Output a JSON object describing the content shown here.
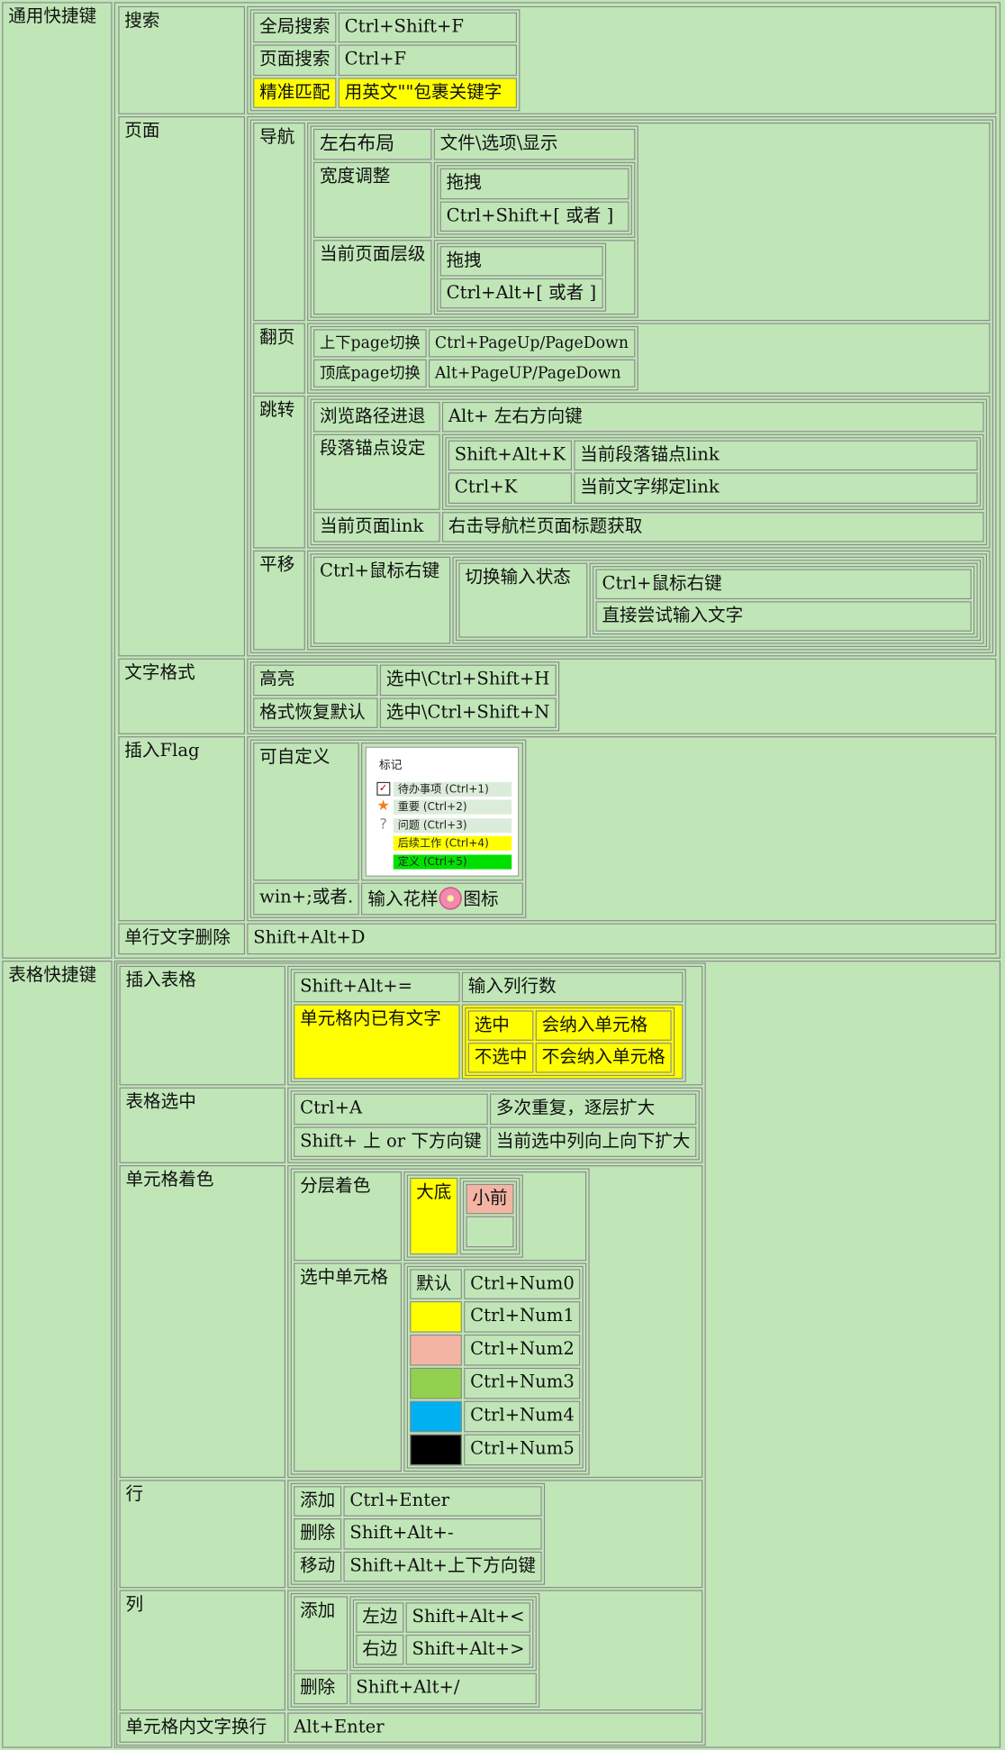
{
  "general": {
    "label": "通用快捷键",
    "search": {
      "label": "搜索",
      "rows": [
        {
          "k": "全局搜索",
          "v": "Ctrl+Shift+F"
        },
        {
          "k": "页面搜索",
          "v": "Ctrl+F"
        },
        {
          "k": "精准匹配",
          "v": "用英文\"\"包裹关键字"
        }
      ]
    },
    "page": {
      "label": "页面",
      "nav": {
        "label": "导航",
        "layout": {
          "k": "左右布局",
          "v": "文件\\选项\\显示"
        },
        "width": {
          "k": "宽度调整",
          "v1": "拖拽",
          "v2": "Ctrl+Shift+[ 或者 ]"
        },
        "level": {
          "k": "当前页面层级",
          "v1": "拖拽",
          "v2": "Ctrl+Alt+[ 或者 ]"
        }
      },
      "flip": {
        "label": "翻页",
        "rows": [
          {
            "k": "上下page切换",
            "v": "Ctrl+PageUp/PageDown"
          },
          {
            "k": "顶底page切换",
            "v": "Alt+PageUP/PageDown"
          }
        ]
      },
      "jump": {
        "label": "跳转",
        "history": {
          "k": "浏览路径进退",
          "v": "Alt+ 左右方向键"
        },
        "anchor": {
          "k": "段落锚点设定",
          "rows": [
            {
              "k": "Shift+Alt+K",
              "v": "当前段落锚点link"
            },
            {
              "k": "Ctrl+K",
              "v": "当前文字绑定link"
            }
          ]
        },
        "link": {
          "k": "当前页面link",
          "v": "右击导航栏页面标题获取"
        }
      },
      "pan": {
        "label": "平移",
        "key": "Ctrl+鼠标右键",
        "toggle": "切换输入状态",
        "opts": [
          "Ctrl+鼠标右键",
          "直接尝试输入文字"
        ]
      }
    },
    "textfmt": {
      "label": "文字格式",
      "rows": [
        {
          "k": "高亮",
          "v": "选中\\Ctrl+Shift+H"
        },
        {
          "k": "格式恢复默认",
          "v": "选中\\Ctrl+Shift+N"
        }
      ]
    },
    "flag": {
      "label": "插入Flag",
      "custom": "可自定义",
      "menu": {
        "title": "标记",
        "items": [
          {
            "icon": "checkbox-icon",
            "label": "待办事项 (Ctrl+1)",
            "bg": "#dcecda"
          },
          {
            "icon": "star-icon",
            "label": "重要 (Ctrl+2)",
            "bg": "#dcecda"
          },
          {
            "icon": "question-icon",
            "label": "问题 (Ctrl+3)",
            "bg": "#dcecda"
          },
          {
            "icon": "",
            "label": "后续工作 (Ctrl+4)",
            "bg": "#ffff00"
          },
          {
            "icon": "",
            "label": "定义 (Ctrl+5)",
            "bg": "#00e000"
          }
        ]
      },
      "alt_key": "win+;或者.",
      "alt_pre": "输入花样",
      "alt_icon": "flower-emoji-icon",
      "alt_post": "图标"
    },
    "delline": {
      "label": "单行文字删除",
      "v": "Shift+Alt+D"
    }
  },
  "table": {
    "label": "表格快捷键",
    "insert": {
      "label": "插入表格",
      "key": "Shift+Alt+=",
      "key_desc": "输入列行数",
      "has_text": "单元格内已有文字",
      "rows": [
        {
          "k": "选中",
          "v": "会纳入单元格"
        },
        {
          "k": "不选中",
          "v": "不会纳入单元格"
        }
      ]
    },
    "select": {
      "label": "表格选中",
      "rows": [
        {
          "k": "Ctrl+A",
          "v": "多次重复，逐层扩大"
        },
        {
          "k": "Shift+ 上 or 下方向键",
          "v": "当前选中列向上向下扩大"
        }
      ]
    },
    "color": {
      "label": "单元格着色",
      "layer": "分层着色",
      "big": "大底",
      "small": "小前",
      "big_color": "#ffff00",
      "small_color": "#f4b4a4",
      "sel": "选中单元格",
      "default": "默认",
      "keys": [
        {
          "color": "",
          "k": "Ctrl+Num0"
        },
        {
          "color": "#ffff00",
          "k": "Ctrl+Num1"
        },
        {
          "color": "#f4b4a4",
          "k": "Ctrl+Num2"
        },
        {
          "color": "#92d050",
          "k": "Ctrl+Num3"
        },
        {
          "color": "#00b0f0",
          "k": "Ctrl+Num4"
        },
        {
          "color": "#000000",
          "k": "Ctrl+Num5"
        }
      ]
    },
    "row": {
      "label": "行",
      "rows": [
        {
          "k": "添加",
          "v": "Ctrl+Enter"
        },
        {
          "k": "删除",
          "v": "Shift+Alt+-"
        },
        {
          "k": "移动",
          "v": "Shift+Alt+上下方向键"
        }
      ]
    },
    "col": {
      "label": "列",
      "add": "添加",
      "add_rows": [
        {
          "k": "左边",
          "v": "Shift+Alt+<"
        },
        {
          "k": "右边",
          "v": "Shift+Alt+>"
        }
      ],
      "del": {
        "k": "删除",
        "v": "Shift+Alt+/"
      }
    },
    "wrap": {
      "label": "单元格内文字换行",
      "v": "Alt+Enter"
    }
  }
}
